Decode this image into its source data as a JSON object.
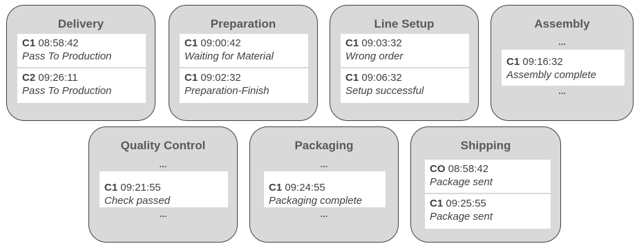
{
  "stations": [
    {
      "title": "Delivery",
      "entries": [
        {
          "code": "C1",
          "time": "08:58:42",
          "status": "Pass To Production"
        },
        {
          "code": "C2",
          "time": "09:26:11",
          "status": "Pass To Production"
        }
      ]
    },
    {
      "title": "Preparation",
      "entries": [
        {
          "code": "C1",
          "time": "09:00:42",
          "status": "Waiting for Material"
        },
        {
          "code": "C1",
          "time": "09:02:32",
          "status": "Preparation-Finish"
        }
      ]
    },
    {
      "title": "Line Setup",
      "entries": [
        {
          "code": "C1",
          "time": "09:03:32",
          "status": "Wrong order"
        },
        {
          "code": "C1",
          "time": "09:06:32",
          "status": "Setup successful"
        }
      ]
    },
    {
      "title": "Assembly",
      "dots_top": "...",
      "entries": [
        {
          "code": "C1",
          "time": "09:16:32",
          "status": "Assembly complete"
        }
      ],
      "dots_bottom": "..."
    },
    {
      "title": "Quality Control",
      "dots_top": "...",
      "entries": [
        {
          "code": "C1",
          "time": "09:21:55",
          "status": "Check passed"
        }
      ],
      "dots_bottom": "..."
    },
    {
      "title": "Packaging",
      "dots_top": "...",
      "entries": [
        {
          "code": "C1",
          "time": "09:24:55",
          "status": "Packaging complete"
        }
      ],
      "dots_bottom": "..."
    },
    {
      "title": "Shipping",
      "entries": [
        {
          "code": "CO",
          "time": "08:58:42",
          "status": "Package sent"
        },
        {
          "code": "C1",
          "time": "09:25:55",
          "status": "Package sent"
        }
      ]
    }
  ]
}
